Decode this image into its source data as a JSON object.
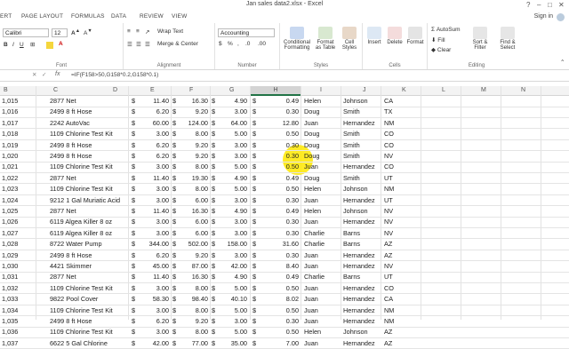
{
  "window": {
    "title": "Jan sales data2.xlsx - Excel",
    "signin": "Sign in"
  },
  "tabs": [
    "ERT",
    "PAGE LAYOUT",
    "FORMULAS",
    "DATA",
    "REVIEW",
    "VIEW"
  ],
  "ribbon": {
    "font_name": "Calibri",
    "font_size": "12",
    "wrap_text": "Wrap Text",
    "merge_center": "Merge & Center",
    "number_format": "Accounting",
    "conditional_formatting": "Conditional Formatting",
    "format_as_table": "Format as Table",
    "cell_styles": "Cell Styles",
    "insert": "Insert",
    "delete": "Delete",
    "format": "Format",
    "autosum": "AutoSum",
    "fill": "Fill",
    "clear": "Clear",
    "sort_filter": "Sort & Filter",
    "find_select": "Find & Select",
    "groups": {
      "font": "Font",
      "alignment": "Alignment",
      "number": "Number",
      "styles": "Styles",
      "cells": "Cells",
      "editing": "Editing"
    }
  },
  "formula_bar": {
    "fx": "fx",
    "formula": "=IF(F158>50,G158*0.2,G158*0.1)"
  },
  "columns": [
    "B",
    "C",
    "D",
    "E",
    "F",
    "G",
    "H",
    "I",
    "J",
    "K",
    "L",
    "M",
    "N"
  ],
  "selected_column": "H",
  "rows": [
    {
      "b": "1,015",
      "item": "2877 Net",
      "e": "11.40",
      "f": "16.30",
      "g": "4.90",
      "h": "0.49",
      "name": "Helen",
      "last": "Johnson",
      "st": "CA"
    },
    {
      "b": "1,016",
      "item": "2499 8 ft Hose",
      "e": "6.20",
      "f": "9.20",
      "g": "3.00",
      "h": "0.30",
      "name": "Doug",
      "last": "Smith",
      "st": "TX"
    },
    {
      "b": "1,017",
      "item": "2242 AutoVac",
      "e": "60.00",
      "f": "124.00",
      "g": "64.00",
      "h": "12.80",
      "name": "Juan",
      "last": "Hernandez",
      "st": "NM"
    },
    {
      "b": "1,018",
      "item": "1109 Chlorine Test Kit",
      "e": "3.00",
      "f": "8.00",
      "g": "5.00",
      "h": "0.50",
      "name": "Doug",
      "last": "Smith",
      "st": "CO"
    },
    {
      "b": "1,019",
      "item": "2499 8 ft Hose",
      "e": "6.20",
      "f": "9.20",
      "g": "3.00",
      "h": "0.30",
      "name": "Doug",
      "last": "Smith",
      "st": "CO"
    },
    {
      "b": "1,020",
      "item": "2499 8 ft Hose",
      "e": "6.20",
      "f": "9.20",
      "g": "3.00",
      "h": "0.30",
      "name": "Doug",
      "last": "Smith",
      "st": "NV"
    },
    {
      "b": "1,021",
      "item": "1109 Chlorine Test Kit",
      "e": "3.00",
      "f": "8.00",
      "g": "5.00",
      "h": "0.50",
      "name": "Juan",
      "last": "Hernandez",
      "st": "CO"
    },
    {
      "b": "1,022",
      "item": "2877 Net",
      "e": "11.40",
      "f": "19.30",
      "g": "4.90",
      "h": "0.49",
      "name": "Doug",
      "last": "Smith",
      "st": "UT"
    },
    {
      "b": "1,023",
      "item": "1109 Chlorine Test Kit",
      "e": "3.00",
      "f": "8.00",
      "g": "5.00",
      "h": "0.50",
      "name": "Helen",
      "last": "Johnson",
      "st": "NM"
    },
    {
      "b": "1,024",
      "item": "9212 1 Gal Muriatic Acid",
      "e": "3.00",
      "f": "6.00",
      "g": "3.00",
      "h": "0.30",
      "name": "Juan",
      "last": "Hernandez",
      "st": "UT"
    },
    {
      "b": "1,025",
      "item": "2877 Net",
      "e": "11.40",
      "f": "16.30",
      "g": "4.90",
      "h": "0.49",
      "name": "Helen",
      "last": "Johnson",
      "st": "NV"
    },
    {
      "b": "1,026",
      "item": "6119 Algea Killer 8 oz",
      "e": "3.00",
      "f": "6.00",
      "g": "3.00",
      "h": "0.30",
      "name": "Juan",
      "last": "Hernandez",
      "st": "NV"
    },
    {
      "b": "1,027",
      "item": "6119 Algea Killer 8 oz",
      "e": "3.00",
      "f": "6.00",
      "g": "3.00",
      "h": "0.30",
      "name": "Charlie",
      "last": "Barns",
      "st": "NV"
    },
    {
      "b": "1,028",
      "item": "8722 Water Pump",
      "e": "344.00",
      "f": "502.00",
      "g": "158.00",
      "h": "31.60",
      "name": "Charlie",
      "last": "Barns",
      "st": "AZ"
    },
    {
      "b": "1,029",
      "item": "2499 8 ft Hose",
      "e": "6.20",
      "f": "9.20",
      "g": "3.00",
      "h": "0.30",
      "name": "Juan",
      "last": "Hernandez",
      "st": "AZ"
    },
    {
      "b": "1,030",
      "item": "4421 Skimmer",
      "e": "45.00",
      "f": "87.00",
      "g": "42.00",
      "h": "8.40",
      "name": "Juan",
      "last": "Hernandez",
      "st": "NV"
    },
    {
      "b": "1,031",
      "item": "2877 Net",
      "e": "11.40",
      "f": "16.30",
      "g": "4.90",
      "h": "0.49",
      "name": "Charlie",
      "last": "Barns",
      "st": "UT"
    },
    {
      "b": "1,032",
      "item": "1109 Chlorine Test Kit",
      "e": "3.00",
      "f": "8.00",
      "g": "5.00",
      "h": "0.50",
      "name": "Juan",
      "last": "Hernandez",
      "st": "CO"
    },
    {
      "b": "1,033",
      "item": "9822 Pool Cover",
      "e": "58.30",
      "f": "98.40",
      "g": "40.10",
      "h": "8.02",
      "name": "Juan",
      "last": "Hernandez",
      "st": "CA"
    },
    {
      "b": "1,034",
      "item": "1109 Chlorine Test Kit",
      "e": "3.00",
      "f": "8.00",
      "g": "5.00",
      "h": "0.50",
      "name": "Juan",
      "last": "Hernandez",
      "st": "NM"
    },
    {
      "b": "1,035",
      "item": "2499 8 ft Hose",
      "e": "6.20",
      "f": "9.20",
      "g": "3.00",
      "h": "0.30",
      "name": "Juan",
      "last": "Hernandez",
      "st": "NM"
    },
    {
      "b": "1,036",
      "item": "1109 Chlorine Test Kit",
      "e": "3.00",
      "f": "8.00",
      "g": "5.00",
      "h": "0.50",
      "name": "Helen",
      "last": "Johnson",
      "st": "AZ"
    },
    {
      "b": "1,037",
      "item": "6622 5 Gal Chlorine",
      "e": "42.00",
      "f": "77.00",
      "g": "35.00",
      "h": "7.00",
      "name": "Juan",
      "last": "Hernandez",
      "st": "AZ"
    }
  ],
  "colors": {
    "excel_green": "#217346",
    "highlight": "#ffe800"
  }
}
